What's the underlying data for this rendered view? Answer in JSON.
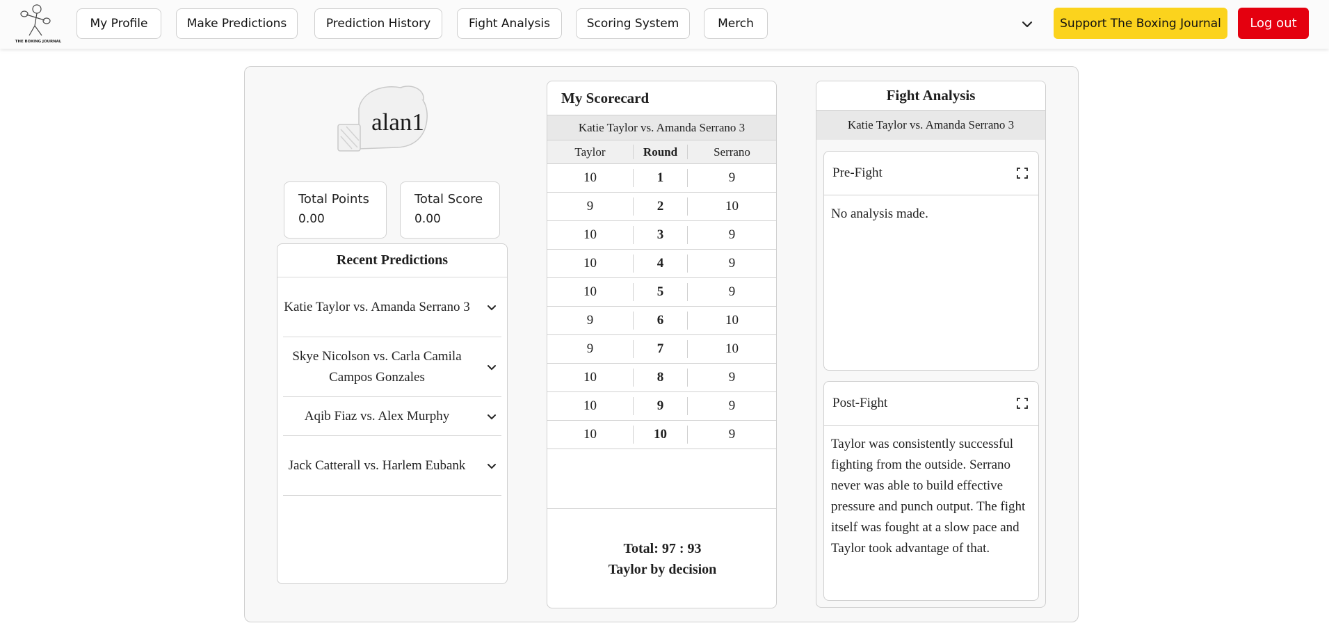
{
  "nav": {
    "logo_text": "THE BOXING JOURNAL",
    "items": [
      {
        "label": "My Profile"
      },
      {
        "label": "Make Predictions"
      },
      {
        "label": "Prediction History"
      },
      {
        "label": "Fight Analysis"
      },
      {
        "label": "Scoring System"
      },
      {
        "label": "Merch"
      }
    ],
    "support_label": "Support The Boxing Journal",
    "logout_label": "Log out",
    "colors": {
      "support": "#fbd31d",
      "logout": "#e4000f"
    }
  },
  "profile": {
    "username": "alan1",
    "total_points_label": "Total Points",
    "total_points_value": "0.00",
    "total_score_label": "Total Score",
    "total_score_value": "0.00"
  },
  "recent": {
    "title": "Recent Predictions",
    "items": [
      {
        "label": "Katie Taylor vs. Amanda Serrano 3"
      },
      {
        "label": "Skye Nicolson vs. Carla Camila Campos Gonzales"
      },
      {
        "label": "Aqib Fiaz vs. Alex Murphy"
      },
      {
        "label": "Jack Catterall vs. Harlem Eubank"
      }
    ]
  },
  "scorecard": {
    "title": "My Scorecard",
    "fight": "Katie Taylor vs. Amanda Serrano 3",
    "headers": {
      "left": "Taylor",
      "round": "Round",
      "right": "Serrano"
    },
    "rows": [
      {
        "left": "10",
        "round": "1",
        "right": "9"
      },
      {
        "left": "9",
        "round": "2",
        "right": "10"
      },
      {
        "left": "10",
        "round": "3",
        "right": "9"
      },
      {
        "left": "10",
        "round": "4",
        "right": "9"
      },
      {
        "left": "10",
        "round": "5",
        "right": "9"
      },
      {
        "left": "9",
        "round": "6",
        "right": "10"
      },
      {
        "left": "9",
        "round": "7",
        "right": "10"
      },
      {
        "left": "10",
        "round": "8",
        "right": "9"
      },
      {
        "left": "10",
        "round": "9",
        "right": "9"
      },
      {
        "left": "10",
        "round": "10",
        "right": "9"
      }
    ],
    "total": "Total: 97 : 93",
    "result": "Taylor by decision"
  },
  "analysis": {
    "title": "Fight Analysis",
    "fight": "Katie Taylor vs. Amanda Serrano 3",
    "pre_title": "Pre-Fight",
    "pre_text": "No analysis made.",
    "post_title": "Post-Fight",
    "post_text": "Taylor was consistently successful fighting from the outside. Serrano never was able to build effective pressure and punch output. The fight itself was fought at a slow pace and Taylor took advantage of that."
  }
}
